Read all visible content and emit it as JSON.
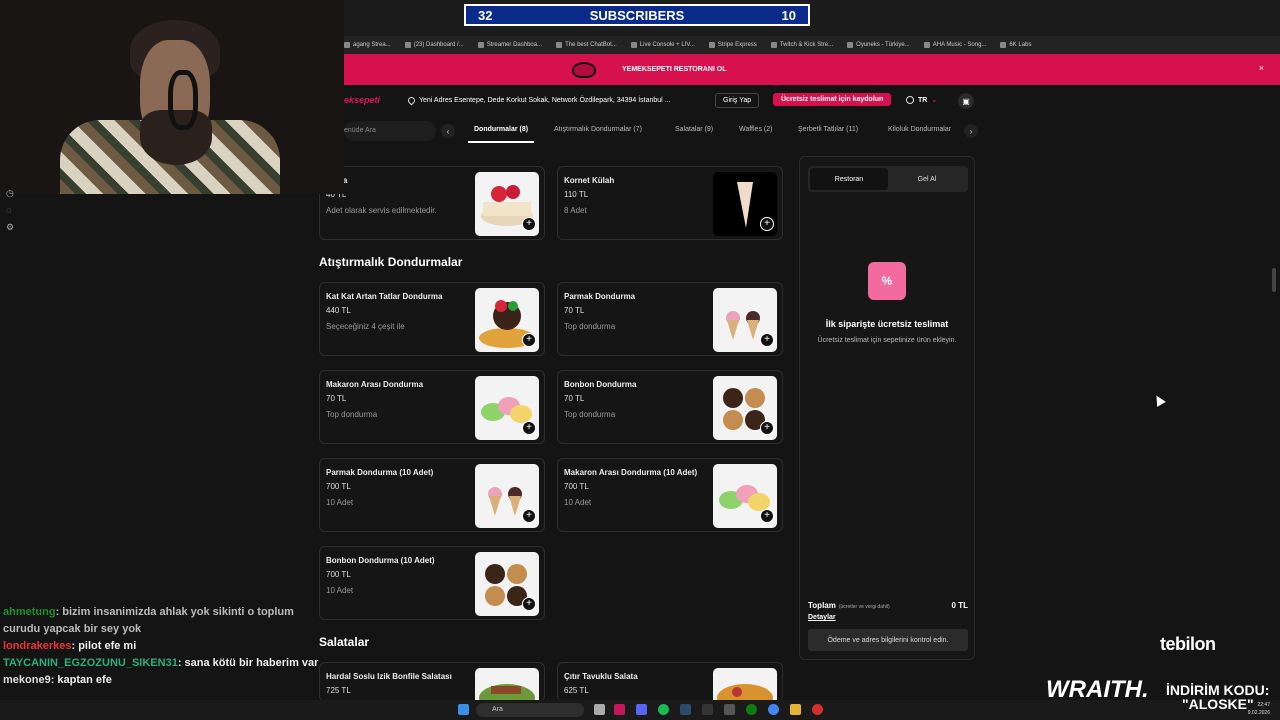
{
  "subscribers_widget": {
    "left": "32",
    "label": "SUBSCRIBERS",
    "right": "10"
  },
  "bookmarks": [
    "agang Strea...",
    "(23) Dashboard /...",
    "Streamer Dashboa...",
    "The best ChatBot...",
    "Live Console + LIV...",
    "Stripe Express",
    "Twitch & Kick Stre...",
    "Oyuneks - Türkiye...",
    "AHA Music - Song...",
    "6K Labs"
  ],
  "promo": {
    "text": "YEMEKSEPETI RESTORANI OL",
    "close": "×"
  },
  "header": {
    "brand": "eksepeti",
    "address": "Yeni Adres Esentepe, Dede Korkut Sokak, Network Özdilepark, 34394 İstanbul ...",
    "login": "Giriş Yap",
    "signup": "Ücretsiz teslimat için kaydolun",
    "lang": "TR"
  },
  "nav": {
    "search_placeholder": "enüde Ara",
    "categories": [
      "Dondurmalar (8)",
      "Atıştırmalık Dondurmalar (7)",
      "Salatalar (9)",
      "Waffles (2)",
      "Şerbetli Tatlılar (11)",
      "Kiloluk Dondurmalar"
    ]
  },
  "menu": {
    "top_items": [
      {
        "name": "Helva",
        "price": "40 TL",
        "desc": "Adet olarak servis edilmektedir."
      },
      {
        "name": "Kornet Külah",
        "price": "110 TL",
        "desc": "8 Adet"
      }
    ],
    "snack_section": "Atıştırmalık Dondurmalar",
    "snack_items": [
      {
        "name": "Kat Kat Artan Tatlar Dondurma",
        "price": "440 TL",
        "desc": "Seçeceğiniz 4 çeşit ile"
      },
      {
        "name": "Parmak Dondurma",
        "price": "70 TL",
        "desc": "Top dondurma"
      },
      {
        "name": "Makaron Arası Dondurma",
        "price": "70 TL",
        "desc": "Top dondurma"
      },
      {
        "name": "Bonbon Dondurma",
        "price": "70 TL",
        "desc": "Top dondurma"
      },
      {
        "name": "Parmak Dondurma (10 Adet)",
        "price": "700 TL",
        "desc": "10 Adet"
      },
      {
        "name": "Makaron Arası Dondurma (10 Adet)",
        "price": "700 TL",
        "desc": "10 Adet"
      },
      {
        "name": "Bonbon Dondurma (10 Adet)",
        "price": "700 TL",
        "desc": "10 Adet"
      }
    ],
    "salad_section": "Salatalar",
    "salad_items": [
      {
        "name": "Hardal Soslu Izik Bonfile Salatası",
        "price": "725 TL"
      },
      {
        "name": "Çıtır Tavuklu Salata",
        "price": "625 TL"
      }
    ]
  },
  "cart": {
    "tab_restaurant": "Restoran",
    "tab_pickup": "Gel Al",
    "free_title": "İlk siparişte ücretsiz teslimat",
    "free_sub": "Ücretsiz teslimat için sepetinize ürün ekleyin.",
    "total_label": "Toplam",
    "total_note": "(ücretler ve vergi dahil)",
    "total_value": "0 TL",
    "details": "Detaylar",
    "checkout": "Ödeme ve adres bilgilerini kontrol edin."
  },
  "chat": [
    {
      "user": "ahmetung",
      "text": ": bizim insanimizda ahlak yok sikinti o toplum curudu yapcak bir sey yok"
    },
    {
      "user": "londrakerkes",
      "text": ": pilot efe mi"
    },
    {
      "user": "TAYCANIN_EGZOZUNU_SIKEN31",
      "text": ": sana kötü bir haberim var"
    },
    {
      "user": "mekone9",
      "text": ": kaptan efe"
    }
  ],
  "taskbar": {
    "search": "Ara",
    "time": "22:47",
    "date": "9.02.2026"
  },
  "overlay": {
    "tebilon": "tebilon",
    "wraith": "WRAITH.",
    "code_label": "İNDİRİM KODU:",
    "code": "\"ALOSKE\""
  }
}
